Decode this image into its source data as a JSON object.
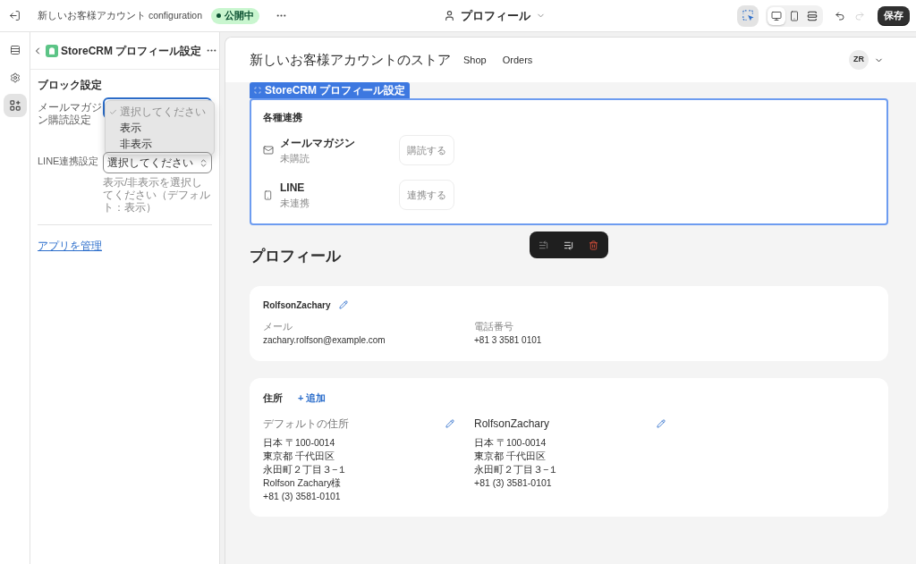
{
  "top_bar": {
    "title": "新しいお客様アカウント configuration",
    "status": "公開中",
    "template": "プロフィール",
    "inspector": {
      "selected": true
    },
    "view_modes": [
      {
        "kind": "desktop",
        "selected": true
      },
      {
        "kind": "mobile",
        "selected": false
      },
      {
        "kind": "fullwidth",
        "selected": false
      }
    ],
    "history": [
      {
        "kind": "undo",
        "disabled": false
      },
      {
        "kind": "redo",
        "disabled": true
      }
    ],
    "save": "保存"
  },
  "rail": [
    {
      "kind": "sections",
      "selected": false
    },
    {
      "kind": "settings",
      "selected": false
    },
    {
      "kind": "apps",
      "selected": true
    }
  ],
  "settings_panel": {
    "title": "StoreCRM プロフィール設定",
    "section_title": "ブロック設定",
    "fields": [
      {
        "label": "メールマガジン購読設定",
        "expanded": true,
        "options": [
          {
            "label": "選択してください",
            "selected": true,
            "disabled": true
          },
          {
            "label": "表示",
            "selected": false,
            "disabled": false
          },
          {
            "label": "非表示",
            "selected": false,
            "disabled": false
          }
        ]
      },
      {
        "label": "LINE連携設定",
        "expanded": false,
        "value": "選択してください",
        "help": "表示/非表示を選択してください（デフォルト：表示）"
      }
    ],
    "manage_link": "アプリを管理"
  },
  "preview": {
    "store_name": "新しいお客様アカウントのストア",
    "nav": [
      "Shop",
      "Orders"
    ],
    "avatar": "ZR",
    "app_block": {
      "selected": true,
      "tag": "StoreCRM プロフィール設定",
      "title": "各種連携",
      "integrations": [
        {
          "kind": "mail",
          "name": "メールマガジン",
          "status": "未購読",
          "action": "購読する"
        },
        {
          "kind": "phone",
          "name": "LINE",
          "status": "未連携",
          "action": "連携する"
        }
      ]
    },
    "block_toolbar": [
      {
        "kind": "move_up",
        "disabled": true
      },
      {
        "kind": "move_down",
        "disabled": false
      },
      {
        "kind": "delete",
        "disabled": false
      }
    ],
    "profile": {
      "heading": "プロフィール",
      "name": "RolfsonZachary",
      "fields": [
        {
          "label": "メール",
          "value": "zachary.rolfson@example.com"
        },
        {
          "label": "電話番号",
          "value": "+81 3 3581 0101"
        }
      ]
    },
    "addresses": {
      "title": "住所",
      "add": "+ 追加",
      "items": [
        {
          "label": "デフォルトの住所",
          "default": true,
          "lines": [
            "日本 〒100-0014",
            "東京都 千代田区",
            "永田町２丁目３−１",
            "Rolfson Zachary様",
            "+81 (3) 3581-0101"
          ]
        },
        {
          "label": "RolfsonZachary",
          "default": false,
          "lines": [
            "日本 〒100-0014",
            "東京都 千代田区",
            "永田町２丁目３−１",
            "+81 (3) 3581-0101"
          ]
        }
      ]
    }
  }
}
